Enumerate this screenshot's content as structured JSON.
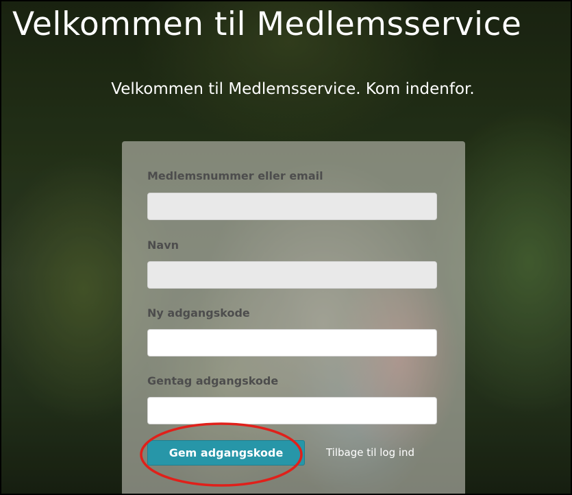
{
  "page": {
    "heading": "Velkommen til Medlemsservice",
    "subheading": "Velkommen til Medlemsservice. Kom indenfor."
  },
  "form": {
    "member_field": {
      "label": "Medlemsnummer eller email",
      "value": "",
      "disabled": true
    },
    "name_field": {
      "label": "Navn",
      "value": "",
      "disabled": true
    },
    "new_password_field": {
      "label": "Ny adgangskode",
      "value": ""
    },
    "repeat_password_field": {
      "label": "Gentag adgangskode",
      "value": ""
    },
    "save_button_label": "Gem adgangskode",
    "back_link_label": "Tilbage til log ind"
  },
  "colors": {
    "primary_button": "#2796a8",
    "annotation": "#e0201a"
  },
  "annotation": {
    "target": "save-button",
    "shape": "ellipse"
  }
}
